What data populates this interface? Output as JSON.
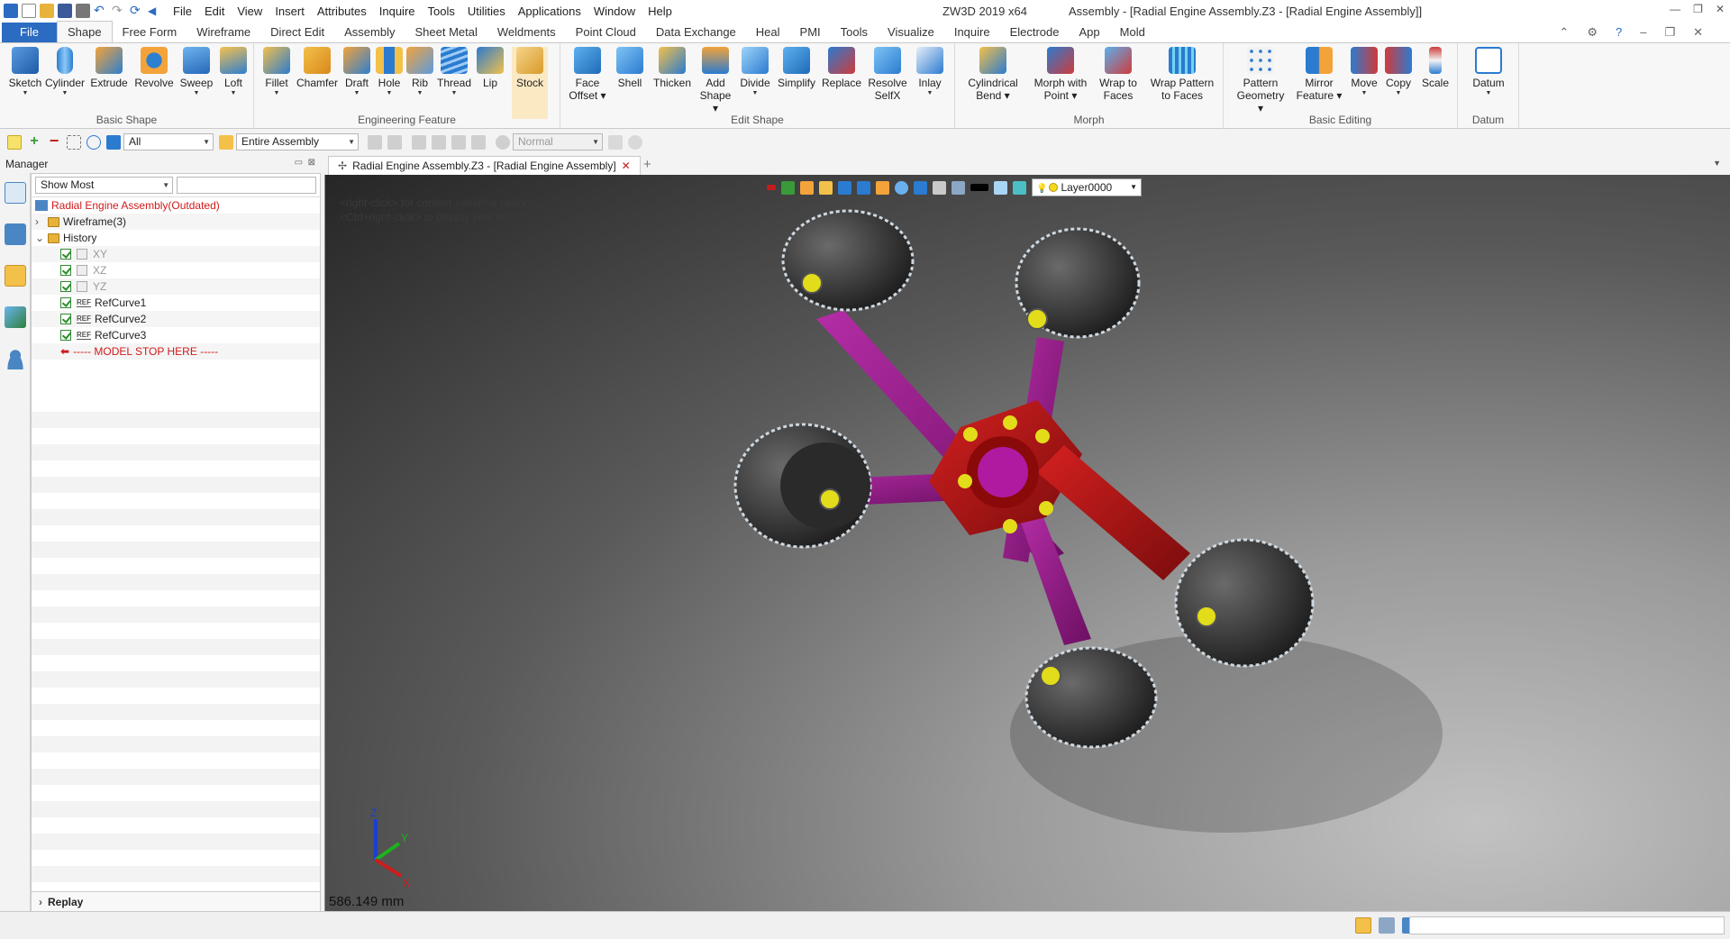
{
  "titlebar": {
    "menus": [
      "File",
      "Edit",
      "View",
      "Insert",
      "Attributes",
      "Inquire",
      "Tools",
      "Utilities",
      "Applications",
      "Window",
      "Help"
    ],
    "app_title": "ZW3D 2019  x64",
    "doc_title": "Assembly - [Radial Engine Assembly.Z3 - [Radial Engine Assembly]]"
  },
  "ribbon_tabs": {
    "file": "File",
    "active": "Shape",
    "tabs": [
      "Free Form",
      "Wireframe",
      "Direct Edit",
      "Assembly",
      "Sheet Metal",
      "Weldments",
      "Point Cloud",
      "Data Exchange",
      "Heal",
      "PMI",
      "Tools",
      "Visualize",
      "Inquire",
      "Electrode",
      "App",
      "Mold"
    ]
  },
  "ribbon": {
    "groups": {
      "basic_shape": "Basic Shape",
      "engineering_feature": "Engineering Feature",
      "edit_shape": "Edit Shape",
      "morph": "Morph",
      "basic_editing": "Basic Editing",
      "datum": "Datum"
    },
    "buttons": {
      "sketch": "Sketch",
      "cylinder": "Cylinder",
      "extrude": "Extrude",
      "revolve": "Revolve",
      "sweep": "Sweep",
      "loft": "Loft",
      "fillet": "Fillet",
      "chamfer": "Chamfer",
      "draft": "Draft",
      "hole": "Hole",
      "rib": "Rib",
      "thread": "Thread",
      "lip": "Lip",
      "stock": "Stock",
      "face_offset_1": "Face",
      "face_offset_2": "Offset",
      "shell": "Shell",
      "thicken": "Thicken",
      "add_shape_1": "Add",
      "add_shape_2": "Shape",
      "divide": "Divide",
      "simplify": "Simplify",
      "replace": "Replace",
      "resolve_1": "Resolve",
      "resolve_2": "SelfX",
      "inlay": "Inlay",
      "cyl_bend_1": "Cylindrical",
      "cyl_bend_2": "Bend",
      "morph_point_1": "Morph with",
      "morph_point_2": "Point",
      "wrap_faces_1": "Wrap to",
      "wrap_faces_2": "Faces",
      "wrap_pattern_1": "Wrap Pattern",
      "wrap_pattern_2": "to Faces",
      "pattern_1": "Pattern",
      "pattern_2": "Geometry",
      "mirror_1": "Mirror",
      "mirror_2": "Feature",
      "move": "Move",
      "copy": "Copy",
      "scale": "Scale",
      "datum": "Datum"
    }
  },
  "toolbar": {
    "filter_value": "All",
    "scope_value": "Entire Assembly",
    "mode_value": "Normal"
  },
  "manager": {
    "title": "Manager",
    "show_filter": "Show Most",
    "tree": {
      "root": "Radial Engine Assembly(Outdated)",
      "wireframe": "Wireframe(3)",
      "history": "History",
      "xy": "XY",
      "xz": "XZ",
      "yz": "YZ",
      "ref1": "RefCurve1",
      "ref2": "RefCurve2",
      "ref3": "RefCurve3",
      "stop": "----- MODEL STOP HERE -----",
      "ref_tag": "REF"
    },
    "replay": "Replay"
  },
  "document": {
    "tab_title": "Radial Engine Assembly.Z3 - [Radial Engine Assembly]",
    "hint1": "<right-click> for context-sensitive options.",
    "hint2": "<Ctrl+right-click> to display pick filter.",
    "layer": "Layer0000",
    "measure": "586.149 mm",
    "axis_x": "X",
    "axis_y": "Y",
    "axis_z": "Z"
  },
  "colors": {
    "accent": "#2b6bc2",
    "crank": "#c01414",
    "rod": "#9b1d8e",
    "piston": "#3d3d3d",
    "pin": "#e2dc1a",
    "outdated_text": "#d11a1a"
  }
}
